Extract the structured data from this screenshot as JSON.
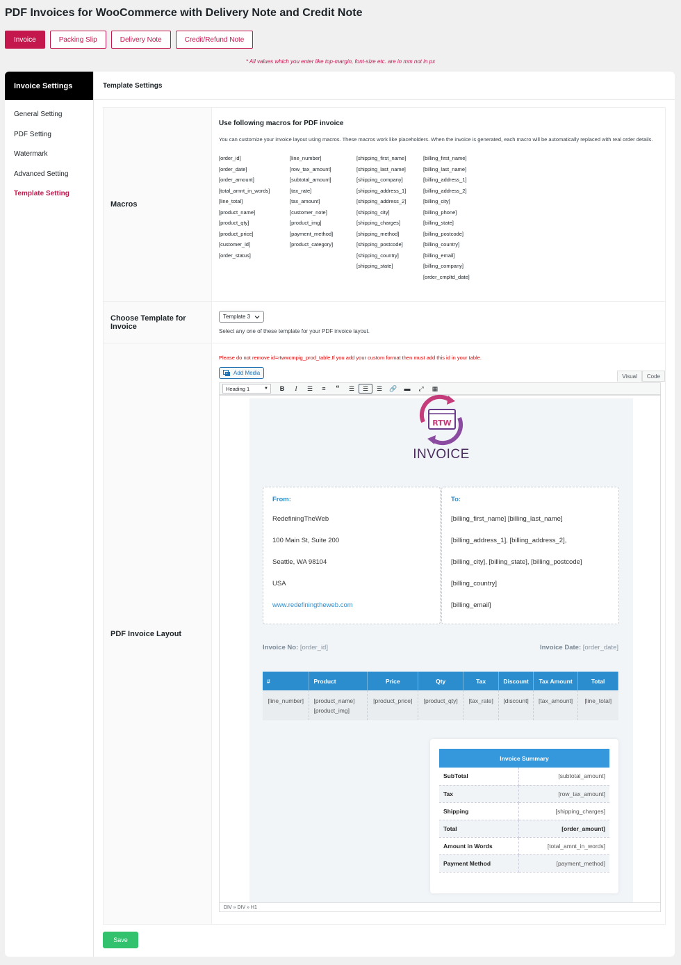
{
  "page_title": "PDF Invoices for WooCommerce with Delivery Note and Credit Note",
  "top_tabs": [
    {
      "label": "Invoice"
    },
    {
      "label": "Packing Slip"
    },
    {
      "label": "Delivery Note"
    },
    {
      "label": "Credit/Refund Note"
    }
  ],
  "notice": "* All values which you enter like top-margin, font-size etc. are in mm not in px",
  "sidebar": {
    "heading": "Invoice Settings",
    "items": [
      {
        "label": "General Setting"
      },
      {
        "label": "PDF Setting"
      },
      {
        "label": "Watermark"
      },
      {
        "label": "Advanced Setting"
      },
      {
        "label": "Template Setting"
      }
    ]
  },
  "content_heading": "Template Settings",
  "macros": {
    "label": "Macros",
    "title": "Use following macros for PDF invoice",
    "description": "You can customize your invoice layout using macros. These macros work like placeholders. When the invoice is generated, each macro will be automatically replaced with real order details.",
    "columns": [
      [
        "[order_id]",
        "[order_date]",
        "[order_amount]",
        "[total_amnt_in_words]",
        "[line_total]",
        "[product_name]",
        "[product_qty]",
        "[product_price]",
        "[customer_id]",
        "[order_status]"
      ],
      [
        "[line_number]",
        "[row_tax_amount]",
        "[subtotal_amount]",
        "[tax_rate]",
        "[tax_amount]",
        "[customer_note]",
        "[product_img]",
        "[payment_method]",
        "[product_category]"
      ],
      [
        "[shipping_first_name]",
        "[shipping_last_name]",
        "[shipping_company]",
        "[shipping_address_1]",
        "[shipping_address_2]",
        "[shipping_city]",
        "[shipping_charges]",
        "[shipping_method]",
        "[shipping_postcode]",
        "[shipping_country]",
        "[shipping_state]"
      ],
      [
        "[billing_first_name]",
        "[billing_last_name]",
        "[billing_address_1]",
        "[billing_address_2]",
        "[billing_city]",
        "[billing_phone]",
        "[billing_state]",
        "[billing_postcode]",
        "[billing_country]",
        "[billing_email]",
        "[billing_company]",
        "[order_cmpltd_date]"
      ]
    ]
  },
  "template": {
    "label": "Choose Template for Invoice",
    "selected": "Template 3",
    "help": "Select any one of these template for your PDF invoice layout."
  },
  "layout": {
    "label": "PDF Invoice Layout",
    "warning": "Please do not remove id=rtwwcmpig_prod_table.If you add your custom format then must add this id in your table.",
    "add_media": "Add Media",
    "tab_visual": "Visual",
    "tab_code": "Code",
    "format_select": "Heading 1",
    "statusbar": "DIV » DIV » H1"
  },
  "invoice": {
    "logo_text": "RTW",
    "title": "INVOICE",
    "from_heading": "From:",
    "from_lines": [
      "RedefiningTheWeb",
      "100 Main St, Suite 200",
      "Seattle, WA 98104",
      "USA"
    ],
    "from_link": "www.redefiningtheweb.com",
    "to_heading": "To:",
    "to_lines": [
      "[billing_first_name] [billing_last_name]",
      "[billing_address_1], [billing_address_2],",
      "[billing_city], [billing_state], [billing_postcode]",
      "[billing_country]",
      "[billing_email]"
    ],
    "invoice_no_label": "Invoice No:",
    "invoice_no_value": "[order_id]",
    "invoice_date_label": "Invoice Date:",
    "invoice_date_value": "[order_date]",
    "table_headers": [
      "#",
      "Product",
      "Price",
      "Qty",
      "Tax",
      "Discount",
      "Tax Amount",
      "Total"
    ],
    "table_row": {
      "num": "[line_number]",
      "product_name": "[product_name]",
      "product_img": "[product_img]",
      "price": "[product_price]",
      "qty": "[product_qty]",
      "tax": "[tax_rate]",
      "discount": "[discount]",
      "tax_amount": "[tax_amount]",
      "total": "[line_total]"
    },
    "summary_heading": "Invoice Summary",
    "summary_rows": [
      {
        "label": "SubTotal",
        "value": "[subtotal_amount]"
      },
      {
        "label": "Tax",
        "value": "[row_tax_amount]"
      },
      {
        "label": "Shipping",
        "value": "[shipping_charges]"
      },
      {
        "label": "Total",
        "value": "[order_amount]"
      },
      {
        "label": "Amount in Words",
        "value": "[total_amnt_in_words]"
      },
      {
        "label": "Payment Method",
        "value": "[payment_method]"
      }
    ]
  },
  "save_label": "Save",
  "colors": {
    "accent": "#c4174e",
    "table_blue": "#2b8dce",
    "save_green": "#32c26e"
  }
}
